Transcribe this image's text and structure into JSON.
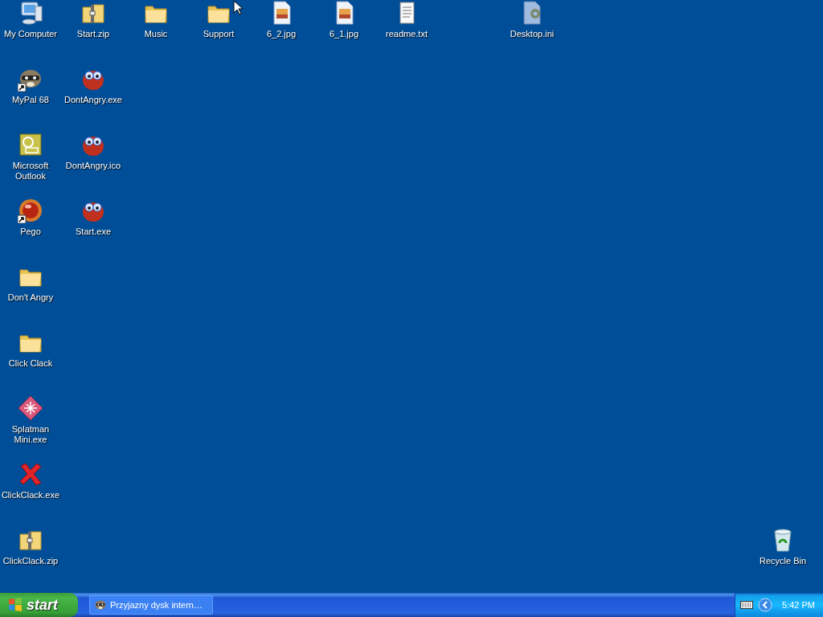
{
  "desktop": {
    "icons": [
      {
        "label": "My Computer",
        "kind": "computer",
        "shortcut": false
      },
      {
        "label": "Start.zip",
        "kind": "zip",
        "shortcut": false
      },
      {
        "label": "Music",
        "kind": "folder",
        "shortcut": false
      },
      {
        "label": "Support",
        "kind": "folder",
        "shortcut": false
      },
      {
        "label": "6_2.jpg",
        "kind": "image",
        "shortcut": false
      },
      {
        "label": "6_1.jpg",
        "kind": "image",
        "shortcut": false
      },
      {
        "label": "readme.txt",
        "kind": "text",
        "shortcut": false
      },
      {
        "label": "Desktop.ini",
        "kind": "settings",
        "shortcut": false
      },
      {
        "label": "MyPal 68",
        "kind": "raccoon",
        "shortcut": true
      },
      {
        "label": "DontAngry.exe",
        "kind": "creature",
        "shortcut": false
      },
      {
        "label": "Microsoft Outlook",
        "kind": "outlook",
        "shortcut": false
      },
      {
        "label": "DontAngry.ico",
        "kind": "creature",
        "shortcut": false
      },
      {
        "label": "Pego",
        "kind": "orb",
        "shortcut": true
      },
      {
        "label": "Start.exe",
        "kind": "creature",
        "shortcut": false
      },
      {
        "label": "Don't Angry",
        "kind": "folder",
        "shortcut": false
      },
      {
        "label": "Click Clack",
        "kind": "folder",
        "shortcut": false
      },
      {
        "label": "Splatman Mini.exe",
        "kind": "diamond",
        "shortcut": false
      },
      {
        "label": "ClickClack.exe",
        "kind": "cross",
        "shortcut": false
      },
      {
        "label": "ClickClack.zip",
        "kind": "zip",
        "shortcut": false
      },
      {
        "label": "Recycle Bin",
        "kind": "recycle",
        "shortcut": false
      }
    ]
  },
  "taskbar": {
    "start": "start",
    "tasks": [
      {
        "label": "Przyjazny dysk intern…",
        "selected": false
      }
    ],
    "clock": "5:42 PM"
  }
}
